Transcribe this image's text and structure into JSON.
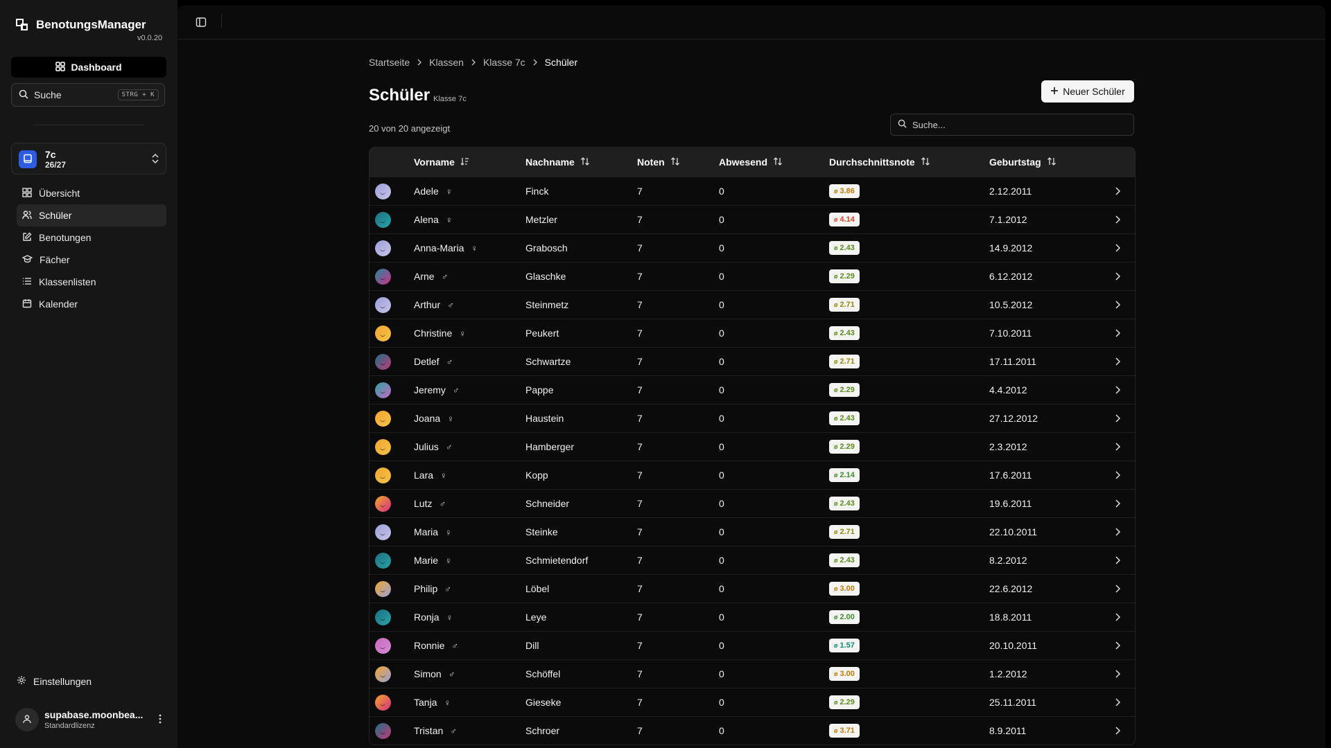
{
  "app": {
    "name": "BenotungsManager",
    "version": "v0.0.20"
  },
  "sidebar": {
    "dashboard_label": "Dashboard",
    "search_label": "Suche",
    "search_shortcut": "STRG + K",
    "class": {
      "name": "7c",
      "year": "26/27",
      "accent": "#2d5ce0"
    },
    "items": [
      {
        "label": "Übersicht",
        "icon": "grid-icon"
      },
      {
        "label": "Schüler",
        "icon": "users-icon",
        "active": true
      },
      {
        "label": "Benotungen",
        "icon": "edit-icon"
      },
      {
        "label": "Fächer",
        "icon": "graduation-cap-icon"
      },
      {
        "label": "Klassenlisten",
        "icon": "list-icon"
      },
      {
        "label": "Kalender",
        "icon": "calendar-icon"
      }
    ],
    "settings_label": "Einstellungen",
    "user": {
      "name": "supabase.moonbea...",
      "license": "Standardlizenz"
    }
  },
  "breadcrumb": [
    "Startseite",
    "Klassen",
    "Klasse 7c",
    "Schüler"
  ],
  "page": {
    "title": "Schüler",
    "subtitle": "Klasse 7c",
    "new_button": "Neuer Schüler",
    "count_text": "20 von 20 angezeigt",
    "search_placeholder": "Suche..."
  },
  "table": {
    "columns": [
      "Vorname",
      "Nachname",
      "Noten",
      "Abwesend",
      "Durchschnittsnote",
      "Geburtstag"
    ],
    "avg_prefix": "ø",
    "rows": [
      {
        "first": "Adele",
        "gender": "♀",
        "last": "Finck",
        "grades": "7",
        "absent": "0",
        "avg": "3.86",
        "birthday": "2.12.2011",
        "avg_color": "#c27a09",
        "avatar": [
          "#9aa0d8",
          "#c8c4e8"
        ]
      },
      {
        "first": "Alena",
        "gender": "♀",
        "last": "Metzler",
        "grades": "7",
        "absent": "0",
        "avg": "4.14",
        "birthday": "7.1.2012",
        "avg_color": "#d4442a",
        "avatar": [
          "#1d6f84",
          "#2aa3a3"
        ]
      },
      {
        "first": "Anna-Maria",
        "gender": "♀",
        "last": "Grabosch",
        "grades": "7",
        "absent": "0",
        "avg": "2.43",
        "birthday": "14.9.2012",
        "avg_color": "#5a8c1a",
        "avatar": [
          "#9aa0d8",
          "#c8c4e8"
        ]
      },
      {
        "first": "Arne",
        "gender": "♂",
        "last": "Glaschke",
        "grades": "7",
        "absent": "0",
        "avg": "2.29",
        "birthday": "6.12.2012",
        "avg_color": "#5a8c1a",
        "avatar": [
          "#1d8a9a",
          "#d12f88"
        ]
      },
      {
        "first": "Arthur",
        "gender": "♂",
        "last": "Steinmetz",
        "grades": "7",
        "absent": "0",
        "avg": "2.71",
        "birthday": "10.5.2012",
        "avg_color": "#8c8a12",
        "avatar": [
          "#9aa0d8",
          "#c8c4e8"
        ]
      },
      {
        "first": "Christine",
        "gender": "♀",
        "last": "Peukert",
        "grades": "7",
        "absent": "0",
        "avg": "2.43",
        "birthday": "7.10.2011",
        "avg_color": "#5a8c1a",
        "avatar": [
          "#f0a62e",
          "#f5c24a"
        ]
      },
      {
        "first": "Detlef",
        "gender": "♂",
        "last": "Schwartze",
        "grades": "7",
        "absent": "0",
        "avg": "2.71",
        "birthday": "17.11.2011",
        "avg_color": "#8c8a12",
        "avatar": [
          "#1d6f84",
          "#c23a7a"
        ]
      },
      {
        "first": "Jeremy",
        "gender": "♂",
        "last": "Pappe",
        "grades": "7",
        "absent": "0",
        "avg": "2.29",
        "birthday": "4.4.2012",
        "avg_color": "#5a8c1a",
        "avatar": [
          "#2aa3a3",
          "#c46ac0"
        ]
      },
      {
        "first": "Joana",
        "gender": "♀",
        "last": "Haustein",
        "grades": "7",
        "absent": "0",
        "avg": "2.43",
        "birthday": "27.12.2012",
        "avg_color": "#5a8c1a",
        "avatar": [
          "#f0a62e",
          "#f5c24a"
        ]
      },
      {
        "first": "Julius",
        "gender": "♂",
        "last": "Hamberger",
        "grades": "7",
        "absent": "0",
        "avg": "2.29",
        "birthday": "2.3.2012",
        "avg_color": "#5a8c1a",
        "avatar": [
          "#f0a62e",
          "#f5c24a"
        ]
      },
      {
        "first": "Lara",
        "gender": "♀",
        "last": "Kopp",
        "grades": "7",
        "absent": "0",
        "avg": "2.14",
        "birthday": "17.6.2011",
        "avg_color": "#3d8c2a",
        "avatar": [
          "#f0a62e",
          "#f5c24a"
        ]
      },
      {
        "first": "Lutz",
        "gender": "♂",
        "last": "Schneider",
        "grades": "7",
        "absent": "0",
        "avg": "2.43",
        "birthday": "19.6.2011",
        "avg_color": "#5a8c1a",
        "avatar": [
          "#f5a623",
          "#d12f88"
        ]
      },
      {
        "first": "Maria",
        "gender": "♀",
        "last": "Steinke",
        "grades": "7",
        "absent": "0",
        "avg": "2.71",
        "birthday": "22.10.2011",
        "avg_color": "#8c8a12",
        "avatar": [
          "#9aa0d8",
          "#c8c4e8"
        ]
      },
      {
        "first": "Marie",
        "gender": "♀",
        "last": "Schmietendorf",
        "grades": "7",
        "absent": "0",
        "avg": "2.43",
        "birthday": "8.2.2012",
        "avg_color": "#5a8c1a",
        "avatar": [
          "#1d6f84",
          "#2aa3a3"
        ]
      },
      {
        "first": "Philip",
        "gender": "♂",
        "last": "Löbel",
        "grades": "7",
        "absent": "0",
        "avg": "3.00",
        "birthday": "22.6.2012",
        "avg_color": "#c27a09",
        "avatar": [
          "#f0a62e",
          "#9aa0d8"
        ]
      },
      {
        "first": "Ronja",
        "gender": "♀",
        "last": "Leye",
        "grades": "7",
        "absent": "0",
        "avg": "2.00",
        "birthday": "18.8.2011",
        "avg_color": "#3d8c2a",
        "avatar": [
          "#1d6f84",
          "#2aa3a3"
        ]
      },
      {
        "first": "Ronnie",
        "gender": "♂",
        "last": "Dill",
        "grades": "7",
        "absent": "0",
        "avg": "1.57",
        "birthday": "20.10.2011",
        "avg_color": "#0f8c70",
        "avatar": [
          "#c46ac0",
          "#d98ad6"
        ]
      },
      {
        "first": "Simon",
        "gender": "♂",
        "last": "Schöffel",
        "grades": "7",
        "absent": "0",
        "avg": "3.00",
        "birthday": "1.2.2012",
        "avg_color": "#c27a09",
        "avatar": [
          "#f0a62e",
          "#9aa0d8"
        ]
      },
      {
        "first": "Tanja",
        "gender": "♀",
        "last": "Gieseke",
        "grades": "7",
        "absent": "0",
        "avg": "2.29",
        "birthday": "25.11.2011",
        "avg_color": "#5a8c1a",
        "avatar": [
          "#f5a623",
          "#d12f88"
        ]
      },
      {
        "first": "Tristan",
        "gender": "♂",
        "last": "Schroer",
        "grades": "7",
        "absent": "0",
        "avg": "3.71",
        "birthday": "8.9.2011",
        "avg_color": "#c27a09",
        "avatar": [
          "#1d6f84",
          "#c23a7a"
        ]
      }
    ]
  }
}
